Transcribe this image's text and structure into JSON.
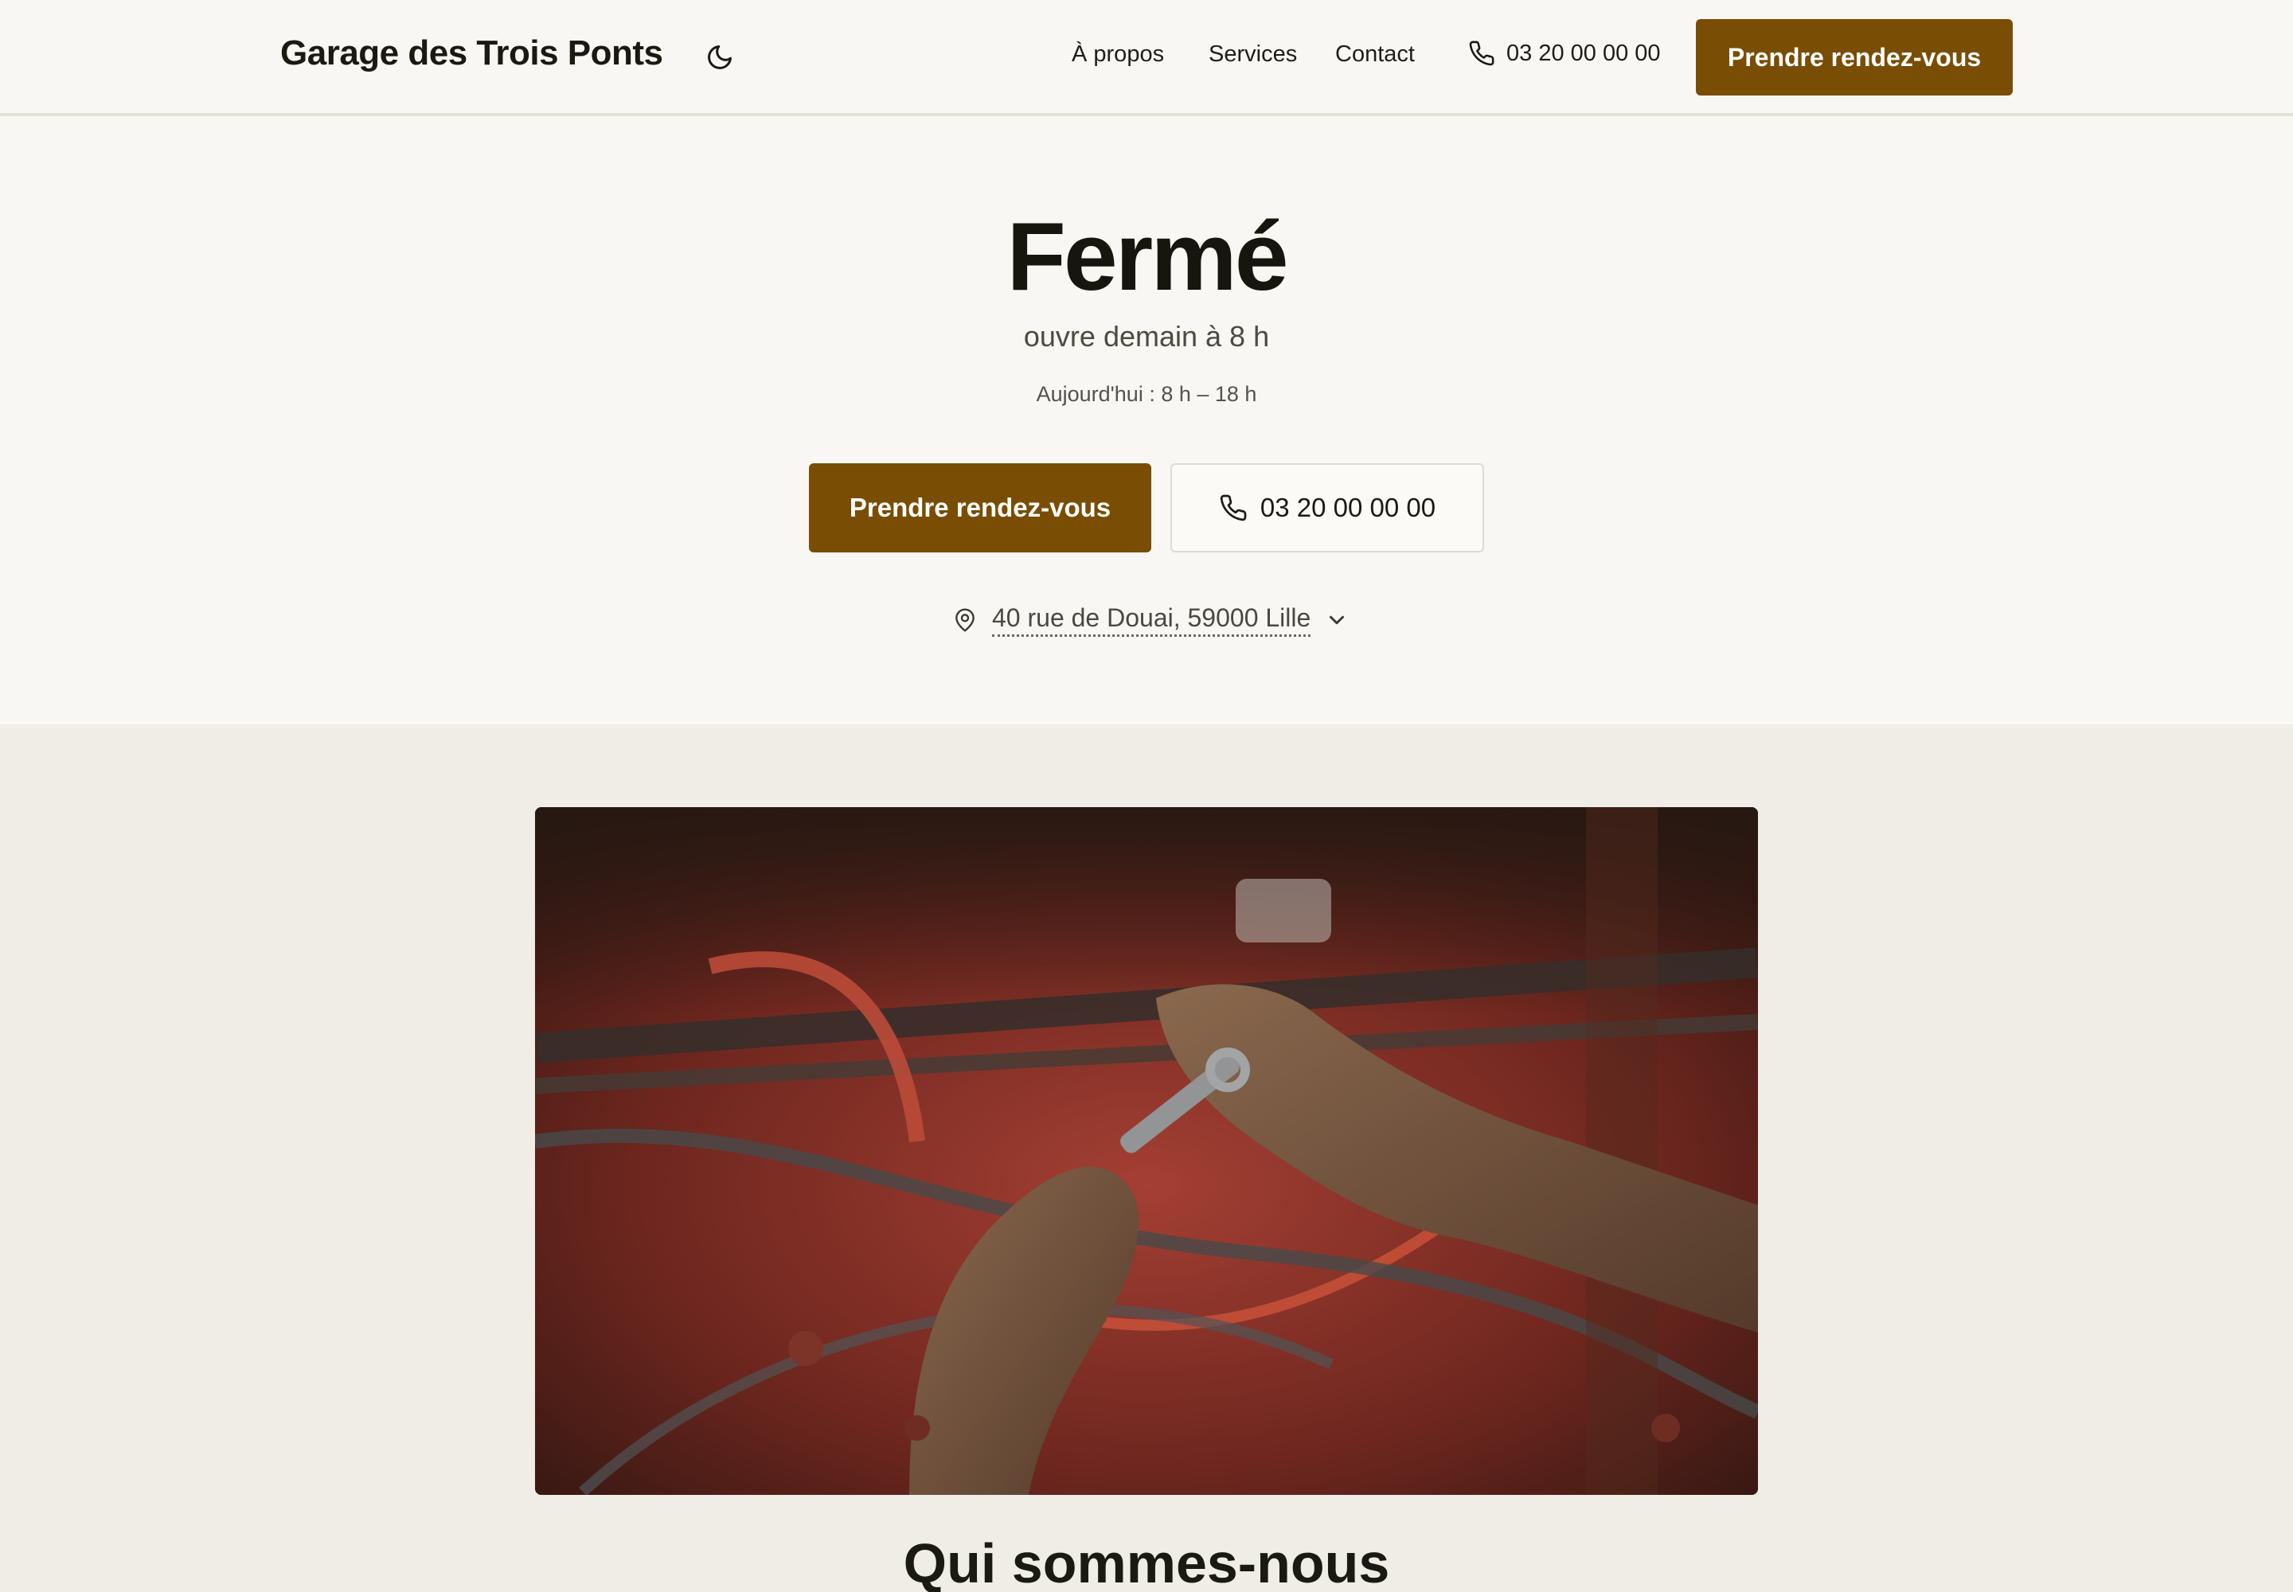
{
  "header": {
    "brand": "Garage des Trois Ponts",
    "nav": [
      {
        "label": "À propos"
      },
      {
        "label": "Services"
      },
      {
        "label": "Contact"
      }
    ],
    "phone": "03 20 00 00 00",
    "cta": "Prendre rendez-vous",
    "icons": {
      "theme": "moon-icon",
      "phone": "phone-icon"
    }
  },
  "hero": {
    "status": "Fermé",
    "next_open": "ouvre demain à 8 h",
    "hours_today": "Aujourd'hui : 8 h – 18 h",
    "primary_button": "Prendre rendez-vous",
    "phone_button": "03 20 00 00 00",
    "address": "40 rue de Douai, 59000 Lille",
    "icons": {
      "address": "map-pin-icon",
      "expand": "chevron-down-icon"
    }
  },
  "about": {
    "title": "Qui sommes-nous"
  },
  "colors": {
    "accent": "#7a4d04",
    "background": "#f8f7f3",
    "section_background": "#efede5",
    "text": "#1b1a12"
  }
}
